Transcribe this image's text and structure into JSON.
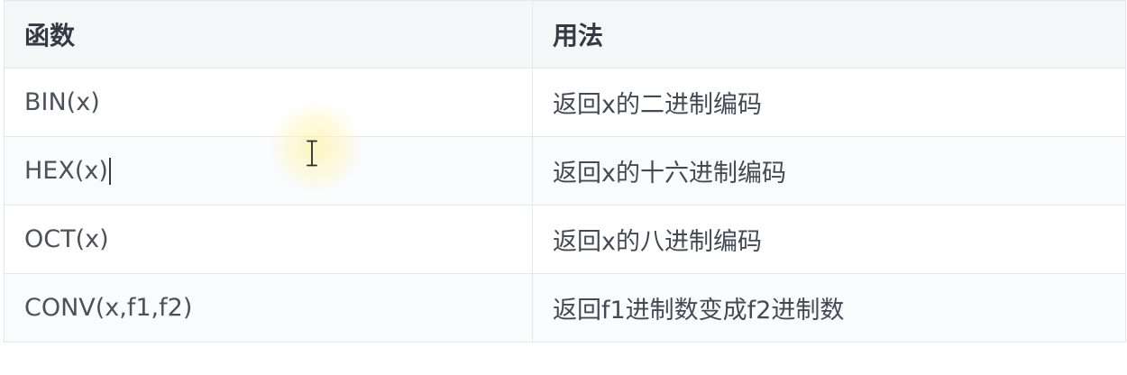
{
  "table": {
    "headers": [
      "函数",
      "用法"
    ],
    "rows": [
      {
        "func": "BIN(x)",
        "usage": "返回x的二进制编码"
      },
      {
        "func": "HEX(x)",
        "usage": "返回x的十六进制编码"
      },
      {
        "func": "OCT(x)",
        "usage": "返回x的八进制编码"
      },
      {
        "func": "CONV(x,f1,f2)",
        "usage": "返回f1进制数变成f2进制数"
      }
    ]
  },
  "cursor": {
    "icon": "text-cursor-icon",
    "highlight_color": "#fff3aa"
  }
}
